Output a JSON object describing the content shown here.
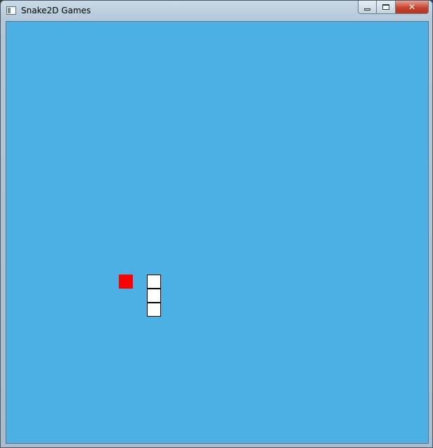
{
  "window": {
    "title": "Snake2D Games",
    "close_glyph": "✕"
  },
  "icons": {
    "app": "app-window-icon",
    "minimize": "minimize-icon",
    "maximize": "maximize-icon",
    "close": "close-icon"
  },
  "colors": {
    "board_background": "#4cb0e4",
    "food": "#ff0000",
    "snake_body": "#ffffff",
    "snake_outline": "#000000"
  },
  "game": {
    "food_cell": {
      "col": 8,
      "row": 18
    },
    "snake_cells": [
      {
        "col": 10,
        "row": 18
      },
      {
        "col": 10,
        "row": 19
      },
      {
        "col": 10,
        "row": 20
      }
    ]
  }
}
